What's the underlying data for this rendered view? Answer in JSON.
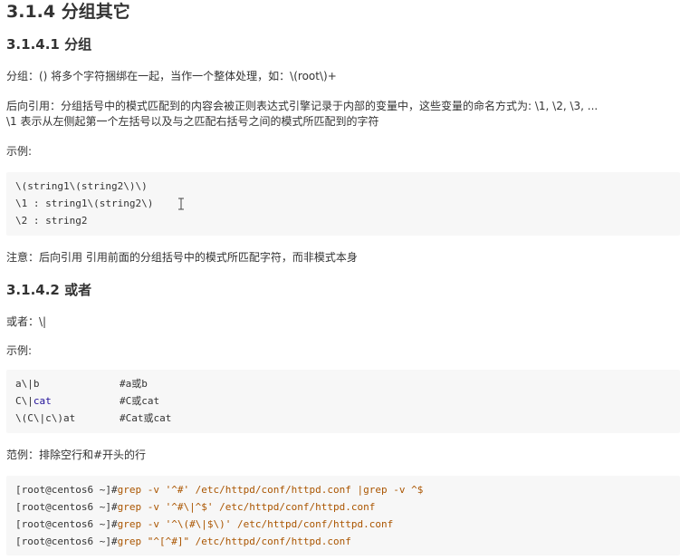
{
  "heading_main": "3.1.4 分组其它",
  "section1": {
    "heading": "3.1.4.1 分组",
    "line1": "分组：() 将多个字符捆绑在一起，当作一个整体处理，如：\\(root\\)+",
    "line2": "后向引用：分组括号中的模式匹配到的内容会被正则表达式引擎记录于内部的变量中，这些变量的命名方式为: \\1, \\2, \\3, ...",
    "line3": "\\1 表示从左侧起第一个左括号以及与之匹配右括号之间的模式所匹配到的字符",
    "example_label": "示例:",
    "code": [
      "\\(string1\\(string2\\)\\)",
      "\\1 : string1\\(string2\\)",
      "\\2 : string2"
    ],
    "note": "注意：后向引用 引用前面的分组括号中的模式所匹配字符，而非模式本身"
  },
  "section2": {
    "heading": "3.1.4.2 或者",
    "line1": "或者：\\|",
    "example_label": "示例:",
    "code": [
      {
        "expr_a": "a\\|b",
        "expr_b": "",
        "comment": "#a或b"
      },
      {
        "expr_a": "C\\|",
        "expr_b": "cat",
        "comment": "#C或cat"
      },
      {
        "expr_a": "\\(C\\|c\\)at",
        "expr_b": "",
        "comment": "#Cat或cat"
      }
    ],
    "example2_label": "范例：排除空行和#开头的行",
    "code2": [
      {
        "prompt": "[root@centos6 ~]#",
        "cmd": "grep -v '^#' /etc/httpd/conf/httpd.conf |grep -v ^$"
      },
      {
        "prompt": "[root@centos6 ~]#",
        "cmd": "grep -v '^#\\|^$' /etc/httpd/conf/httpd.conf"
      },
      {
        "prompt": "[root@centos6 ~]#",
        "cmd": "grep -v '^\\(#\\|$\\)' /etc/httpd/conf/httpd.conf"
      },
      {
        "prompt": "[root@centos6 ~]#",
        "cmd": "grep \"^[^#]\" /etc/httpd/conf/httpd.conf"
      }
    ]
  },
  "colors": {
    "code_bg": "#f7f7f7",
    "code_red": "#e4342b",
    "code_comment": "#aa5500",
    "code_keyword": "#770088"
  }
}
